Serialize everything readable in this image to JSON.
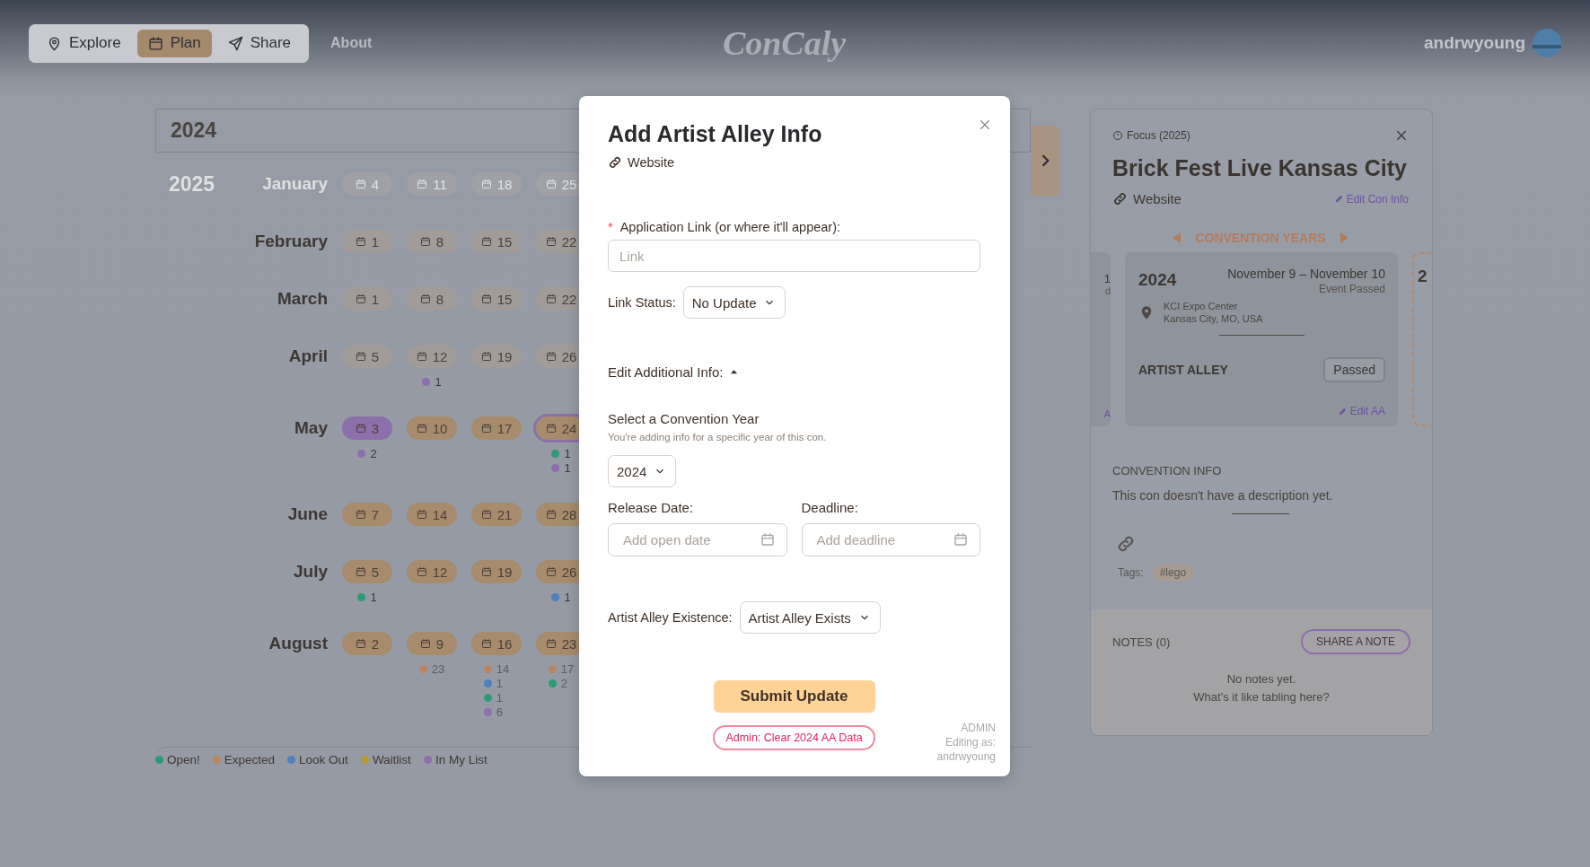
{
  "nav": {
    "items": [
      {
        "label": "Explore",
        "selected": false
      },
      {
        "label": "Plan",
        "selected": true
      },
      {
        "label": "Share",
        "selected": false
      }
    ],
    "about": "About",
    "logo": "ConCaly",
    "user": "andrwyoung"
  },
  "calendar": {
    "year_input": "2024",
    "year_label": "2025",
    "months": [
      {
        "name": "January",
        "faded": true,
        "weeks": [
          {
            "day": "4",
            "kind": "past"
          },
          {
            "day": "11",
            "kind": "past"
          },
          {
            "day": "18",
            "kind": "past"
          },
          {
            "day": "25",
            "kind": "past"
          }
        ]
      },
      {
        "name": "February",
        "faded": false,
        "weeks": [
          {
            "day": "1",
            "kind": "past"
          },
          {
            "day": "8",
            "kind": "past"
          },
          {
            "day": "15",
            "kind": "past"
          },
          {
            "day": "22",
            "kind": "past"
          }
        ]
      },
      {
        "name": "March",
        "faded": false,
        "weeks": [
          {
            "day": "1",
            "kind": "past"
          },
          {
            "day": "8",
            "kind": "past"
          },
          {
            "day": "15",
            "kind": "past"
          },
          {
            "day": "22",
            "kind": "past"
          }
        ]
      },
      {
        "name": "April",
        "faded": false,
        "weeks": [
          {
            "day": "5",
            "kind": "past"
          },
          {
            "day": "12",
            "kind": "past",
            "counts": [
              {
                "color": "#8d6fae",
                "count": "1",
                "faded": false
              }
            ]
          },
          {
            "day": "19",
            "kind": "past"
          },
          {
            "day": "26",
            "kind": "past"
          }
        ]
      },
      {
        "name": "May",
        "faded": false,
        "weeks": [
          {
            "day": "3",
            "kind": "listed",
            "counts": [
              {
                "color": "#8d6fae",
                "count": "2",
                "faded": false
              }
            ]
          },
          {
            "day": "10",
            "kind": "future"
          },
          {
            "day": "17",
            "kind": "future"
          },
          {
            "day": "24",
            "kind": "current",
            "counts": [
              {
                "color": "#2d9a78",
                "count": "1",
                "faded": false
              },
              {
                "color": "#8d6fae",
                "count": "1",
                "faded": false
              }
            ]
          }
        ]
      },
      {
        "name": "June",
        "faded": false,
        "weeks": [
          {
            "day": "7",
            "kind": "future"
          },
          {
            "day": "14",
            "kind": "future"
          },
          {
            "day": "21",
            "kind": "future"
          },
          {
            "day": "28",
            "kind": "future"
          }
        ]
      },
      {
        "name": "July",
        "faded": false,
        "weeks": [
          {
            "day": "5",
            "kind": "future",
            "counts": [
              {
                "color": "#2d9a78",
                "count": "1",
                "faded": false
              }
            ]
          },
          {
            "day": "12",
            "kind": "future"
          },
          {
            "day": "19",
            "kind": "future"
          },
          {
            "day": "26",
            "kind": "future",
            "counts": [
              {
                "color": "#4f80bd",
                "count": "1",
                "faded": false
              }
            ]
          }
        ]
      },
      {
        "name": "August",
        "faded": false,
        "weeks": [
          {
            "day": "2",
            "kind": "future"
          },
          {
            "day": "9",
            "kind": "future",
            "counts": [
              {
                "color": "#b98661",
                "count": "23",
                "faded": true
              }
            ]
          },
          {
            "day": "16",
            "kind": "future",
            "counts": [
              {
                "color": "#b98661",
                "count": "14",
                "faded": true
              },
              {
                "color": "#4f80bd",
                "count": "1",
                "faded": true
              },
              {
                "color": "#2d9a78",
                "count": "1",
                "faded": true
              },
              {
                "color": "#8d6fae",
                "count": "6",
                "faded": true
              }
            ]
          },
          {
            "day": "23",
            "kind": "future",
            "counts": [
              {
                "color": "#b98661",
                "count": "17",
                "faded": true
              },
              {
                "color": "#2d9a78",
                "count": "2",
                "faded": true
              }
            ]
          }
        ]
      }
    ],
    "legend": [
      {
        "label": "Open!",
        "color": "#2d9a78"
      },
      {
        "label": "Expected",
        "color": "#b98661"
      },
      {
        "label": "Look Out",
        "color": "#4f80bd"
      },
      {
        "label": "Waitlist",
        "color": "#b59a3a"
      },
      {
        "label": "In My List",
        "color": "#8d6fae"
      }
    ]
  },
  "con_panel": {
    "focus": "Focus (2025)",
    "title": "Brick Fest Live Kansas City",
    "website": "Website",
    "edit_con": "Edit Con Info",
    "years_heading": "CONVENTION YEARS",
    "prev_card": {
      "line_1": "1",
      "line_2": "d",
      "link": "A"
    },
    "card": {
      "year": "2024",
      "dates": "November 9 – November 10",
      "status": "Event Passed",
      "venue": "KCI Expo Center",
      "location": "Kansas City, MO, USA",
      "aa_label": "ARTIST ALLEY",
      "aa_status": "Passed",
      "edit_aa": "Edit AA"
    },
    "next_card": {
      "year": "2"
    },
    "info_heading": "CONVENTION INFO",
    "description": "This con doesn't have a description yet.",
    "tags_label": "Tags:",
    "tags": [
      "#lego"
    ],
    "notes_heading": "NOTES (0)",
    "share_note": "SHARE A NOTE",
    "empty_1": "No notes yet.",
    "empty_2": "What's it like tabling here?"
  },
  "modal": {
    "title": "Add Artist Alley Info",
    "website": "Website",
    "required_mark": "*",
    "link_label": "Application Link (or where it'll appear):",
    "link_placeholder": "Link",
    "status_label": "Link Status:",
    "status_value": "No Update",
    "additional_label": "Edit Additional Info:",
    "additional_expanded": true,
    "year_heading": "Select a Convention Year",
    "year_hint": "You're adding info for a specific year of this con.",
    "year_value": "2024",
    "release_label": "Release Date:",
    "release_placeholder": "Add open date",
    "deadline_label": "Deadline:",
    "deadline_placeholder": "Add deadline",
    "existence_label": "Artist Alley Existence:",
    "existence_value": "Artist Alley Exists",
    "submit": "Submit Update",
    "admin_clear": "Admin: Clear 2024 AA Data",
    "admin_note": [
      "ADMIN",
      "Editing as:",
      "andrwyoung"
    ]
  }
}
